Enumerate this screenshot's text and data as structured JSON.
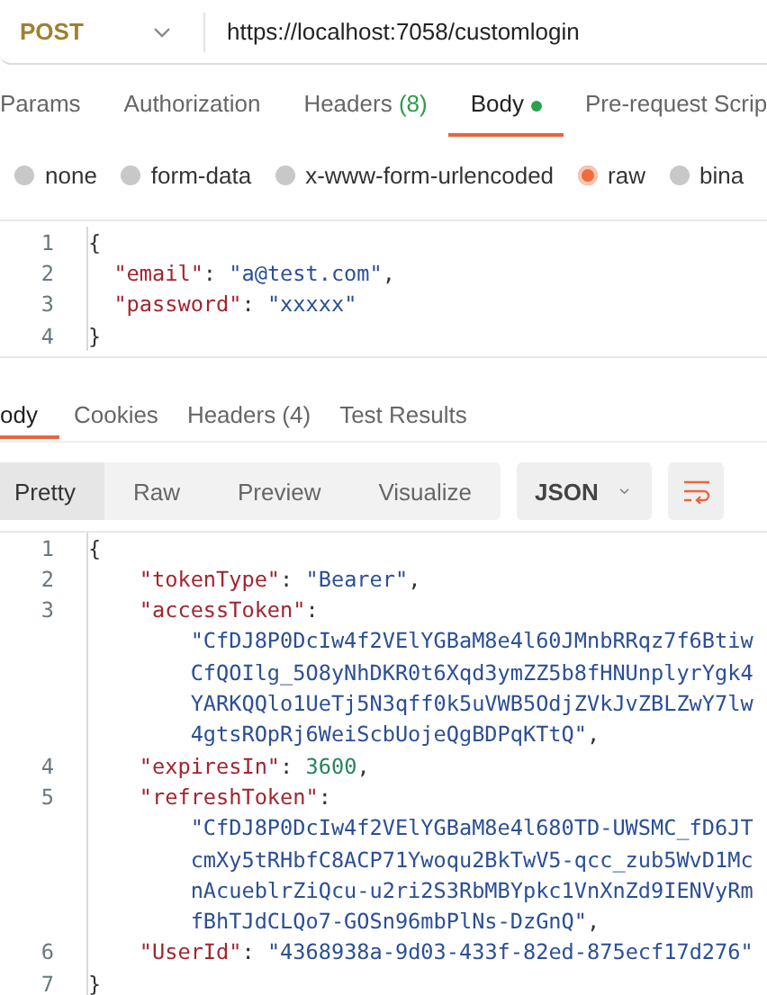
{
  "request": {
    "method": "POST",
    "url": "https://localhost:7058/customlogin"
  },
  "request_tabs": [
    {
      "label": "Params",
      "selected": false
    },
    {
      "label": "Authorization",
      "selected": false
    },
    {
      "label": "Headers",
      "count": "(8)",
      "selected": false
    },
    {
      "label": "Body",
      "selected": true,
      "has_content": true
    },
    {
      "label": "Pre-request Scrip",
      "selected": false
    }
  ],
  "body_types": [
    {
      "label": "none",
      "selected": false
    },
    {
      "label": "form-data",
      "selected": false
    },
    {
      "label": "x-www-form-urlencoded",
      "selected": false
    },
    {
      "label": "raw",
      "selected": true
    },
    {
      "label": "bina",
      "selected": false
    }
  ],
  "request_body": [
    {
      "number": "1",
      "kind": "brace",
      "segments": [
        {
          "kind": "punct",
          "text": "{"
        }
      ]
    },
    {
      "number": "2",
      "kind": "member_short",
      "segments": [
        {
          "kind": "key",
          "text": "\"email\""
        },
        {
          "kind": "punct",
          "text": ": "
        },
        {
          "kind": "string",
          "text": "\"a@test.com\""
        },
        {
          "kind": "punct",
          "text": ","
        }
      ]
    },
    {
      "number": "3",
      "kind": "member_short",
      "segments": [
        {
          "kind": "key",
          "text": "\"password\""
        },
        {
          "kind": "punct",
          "text": ": "
        },
        {
          "kind": "string",
          "text": "\"xxxxx\""
        }
      ]
    },
    {
      "number": "4",
      "kind": "brace",
      "segments": [
        {
          "kind": "punct",
          "text": "}"
        }
      ]
    }
  ],
  "response_tabs": [
    {
      "label": "ody",
      "selected": true
    },
    {
      "label": "Cookies",
      "selected": false
    },
    {
      "label": "Headers (4)",
      "selected": false
    },
    {
      "label": "Test Results",
      "selected": false
    }
  ],
  "view_modes": [
    {
      "label": "Pretty",
      "selected": true
    },
    {
      "label": "Raw",
      "selected": false
    },
    {
      "label": "Preview",
      "selected": false
    },
    {
      "label": "Visualize",
      "selected": false
    }
  ],
  "format": "JSON",
  "response_body": [
    {
      "number": "1",
      "kind": "brace",
      "segments": [
        {
          "kind": "punct",
          "text": "{"
        }
      ]
    },
    {
      "number": "2",
      "kind": "member",
      "segments": [
        {
          "kind": "key",
          "text": "\"tokenType\""
        },
        {
          "kind": "punct",
          "text": ": "
        },
        {
          "kind": "string",
          "text": "\"Bearer\""
        },
        {
          "kind": "punct",
          "text": ","
        }
      ]
    },
    {
      "number": "3",
      "kind": "member",
      "segments": [
        {
          "kind": "key",
          "text": "\"accessToken\""
        },
        {
          "kind": "punct",
          "text": ":"
        }
      ]
    },
    {
      "kind": "wrapped",
      "segments": [
        {
          "kind": "string",
          "text": "\"CfDJ8P0DcIw4f2VElYGBaM8e4l60JMnbRRqz7f6Btiw"
        }
      ]
    },
    {
      "kind": "wrapped",
      "segments": [
        {
          "kind": "string",
          "text": "CfQOIlg_5O8yNhDKR0t6Xqd3ymZZ5b8fHNUnplyrYgk4"
        }
      ]
    },
    {
      "kind": "wrapped",
      "segments": [
        {
          "kind": "string",
          "text": "YARKQQlo1UeTj5N3qff0k5uVWB5OdjZVkJvZBLZwY7lw"
        }
      ]
    },
    {
      "kind": "wrapped",
      "segments": [
        {
          "kind": "string",
          "text": "4gtsROpRj6WeiScbUojeQgBDPqKTtQ\""
        },
        {
          "kind": "punct",
          "text": ","
        }
      ]
    },
    {
      "number": "4",
      "kind": "member",
      "segments": [
        {
          "kind": "key",
          "text": "\"expiresIn\""
        },
        {
          "kind": "punct",
          "text": ": "
        },
        {
          "kind": "number",
          "text": "3600"
        },
        {
          "kind": "punct",
          "text": ","
        }
      ]
    },
    {
      "number": "5",
      "kind": "member",
      "segments": [
        {
          "kind": "key",
          "text": "\"refreshToken\""
        },
        {
          "kind": "punct",
          "text": ":"
        }
      ]
    },
    {
      "kind": "wrapped",
      "segments": [
        {
          "kind": "string",
          "text": "\"CfDJ8P0DcIw4f2VElYGBaM8e4l680TD-UWSMC_fD6JT"
        }
      ]
    },
    {
      "kind": "wrapped",
      "segments": [
        {
          "kind": "string",
          "text": "cmXy5tRHbfC8ACP71Ywoqu2BkTwV5-qcc_zub5WvD1Mc"
        }
      ]
    },
    {
      "kind": "wrapped",
      "segments": [
        {
          "kind": "string",
          "text": "nAcueblrZiQcu-u2ri2S3RbMBYpkc1VnXnZd9IENVyRm"
        }
      ]
    },
    {
      "kind": "wrapped",
      "segments": [
        {
          "kind": "string",
          "text": "fBhTJdCLQo7-GOSn96mbPlNs-DzGnQ\""
        },
        {
          "kind": "punct",
          "text": ","
        }
      ]
    },
    {
      "number": "6",
      "kind": "member",
      "segments": [
        {
          "kind": "key",
          "text": "\"UserId\""
        },
        {
          "kind": "punct",
          "text": ": "
        },
        {
          "kind": "string",
          "text": "\"4368938a-9d03-433f-82ed-875ecf17d276\""
        }
      ]
    },
    {
      "number": "7",
      "kind": "brace",
      "segments": [
        {
          "kind": "punct",
          "text": "}"
        }
      ]
    }
  ]
}
